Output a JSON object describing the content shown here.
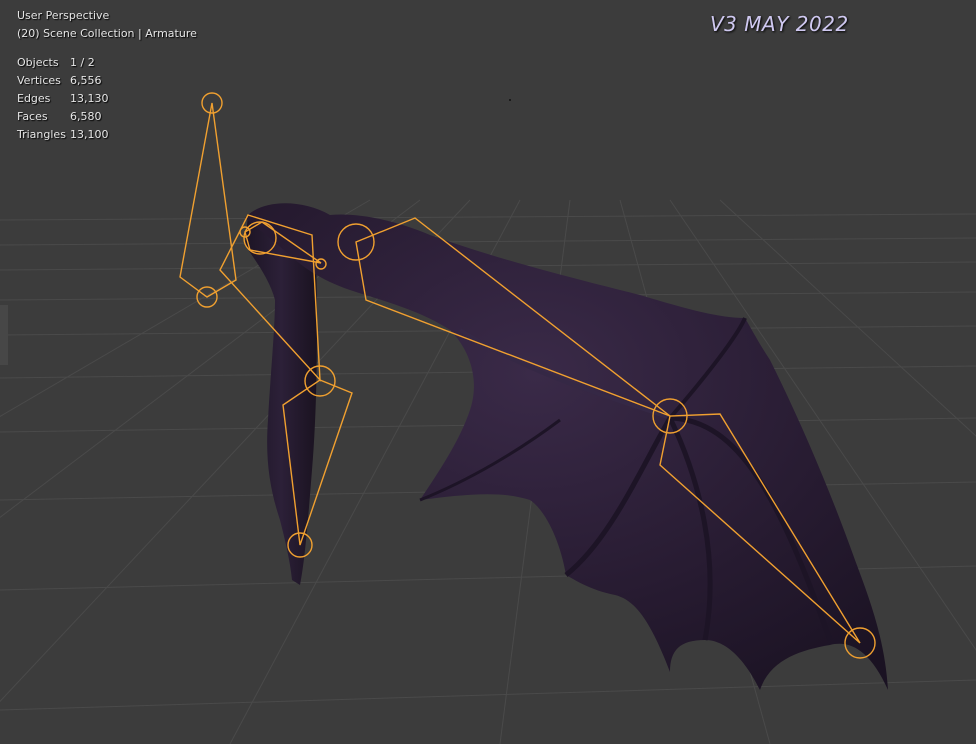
{
  "viewport": {
    "view_name": "User Perspective",
    "collection_label": "(20) Scene Collection | Armature",
    "version_label": "V3 MAY 2022",
    "background_color": "#3c3c3c",
    "grid_color": "#4a4a4a",
    "bone_color": "#f0a030",
    "mesh_color": "#2a1e33"
  },
  "stats": [
    {
      "label": "Objects",
      "value": "1 / 2"
    },
    {
      "label": "Vertices",
      "value": "6,556"
    },
    {
      "label": "Edges",
      "value": "13,130"
    },
    {
      "label": "Faces",
      "value": "6,580"
    },
    {
      "label": "Triangles",
      "value": "13,100"
    }
  ]
}
